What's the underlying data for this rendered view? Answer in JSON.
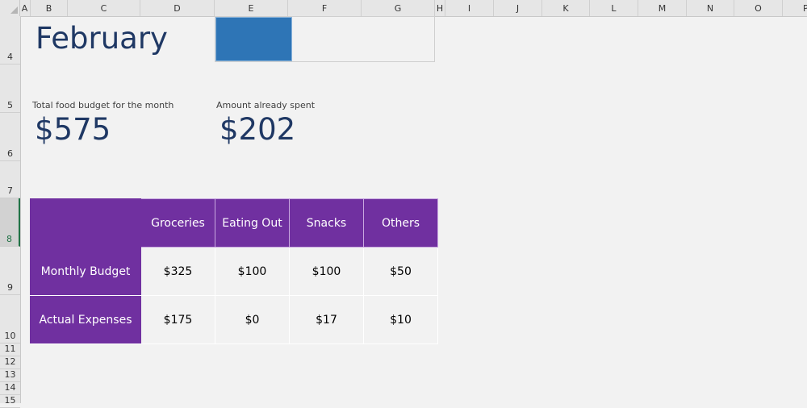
{
  "sheet": {
    "column_headers": [
      "A",
      "B",
      "C",
      "D",
      "E",
      "F",
      "G",
      "H",
      "I",
      "J",
      "K",
      "L",
      "M",
      "N",
      "O",
      "P"
    ],
    "row_headers": [
      "4",
      "5",
      "6",
      "7",
      "8",
      "9",
      "10",
      "11",
      "12",
      "13",
      "14",
      "15"
    ],
    "selected_row": "8"
  },
  "title": {
    "month": "February"
  },
  "progress": {
    "spent_fraction": 0.35,
    "fill_color": "#2e75b6"
  },
  "summary": {
    "budget_label": "Total food budget for the month",
    "budget_value": "$575",
    "spent_label": "Amount already spent",
    "spent_value": "$202"
  },
  "table": {
    "header_color": "#7030a0",
    "columns": [
      "",
      "Groceries",
      "Eating Out",
      "Snacks",
      "Others"
    ],
    "rows": [
      {
        "label": "Monthly Budget",
        "values": [
          "$325",
          "$100",
          "$100",
          "$50"
        ]
      },
      {
        "label": "Actual Expenses",
        "values": [
          "$175",
          "$0",
          "$17",
          "$10"
        ]
      }
    ]
  }
}
